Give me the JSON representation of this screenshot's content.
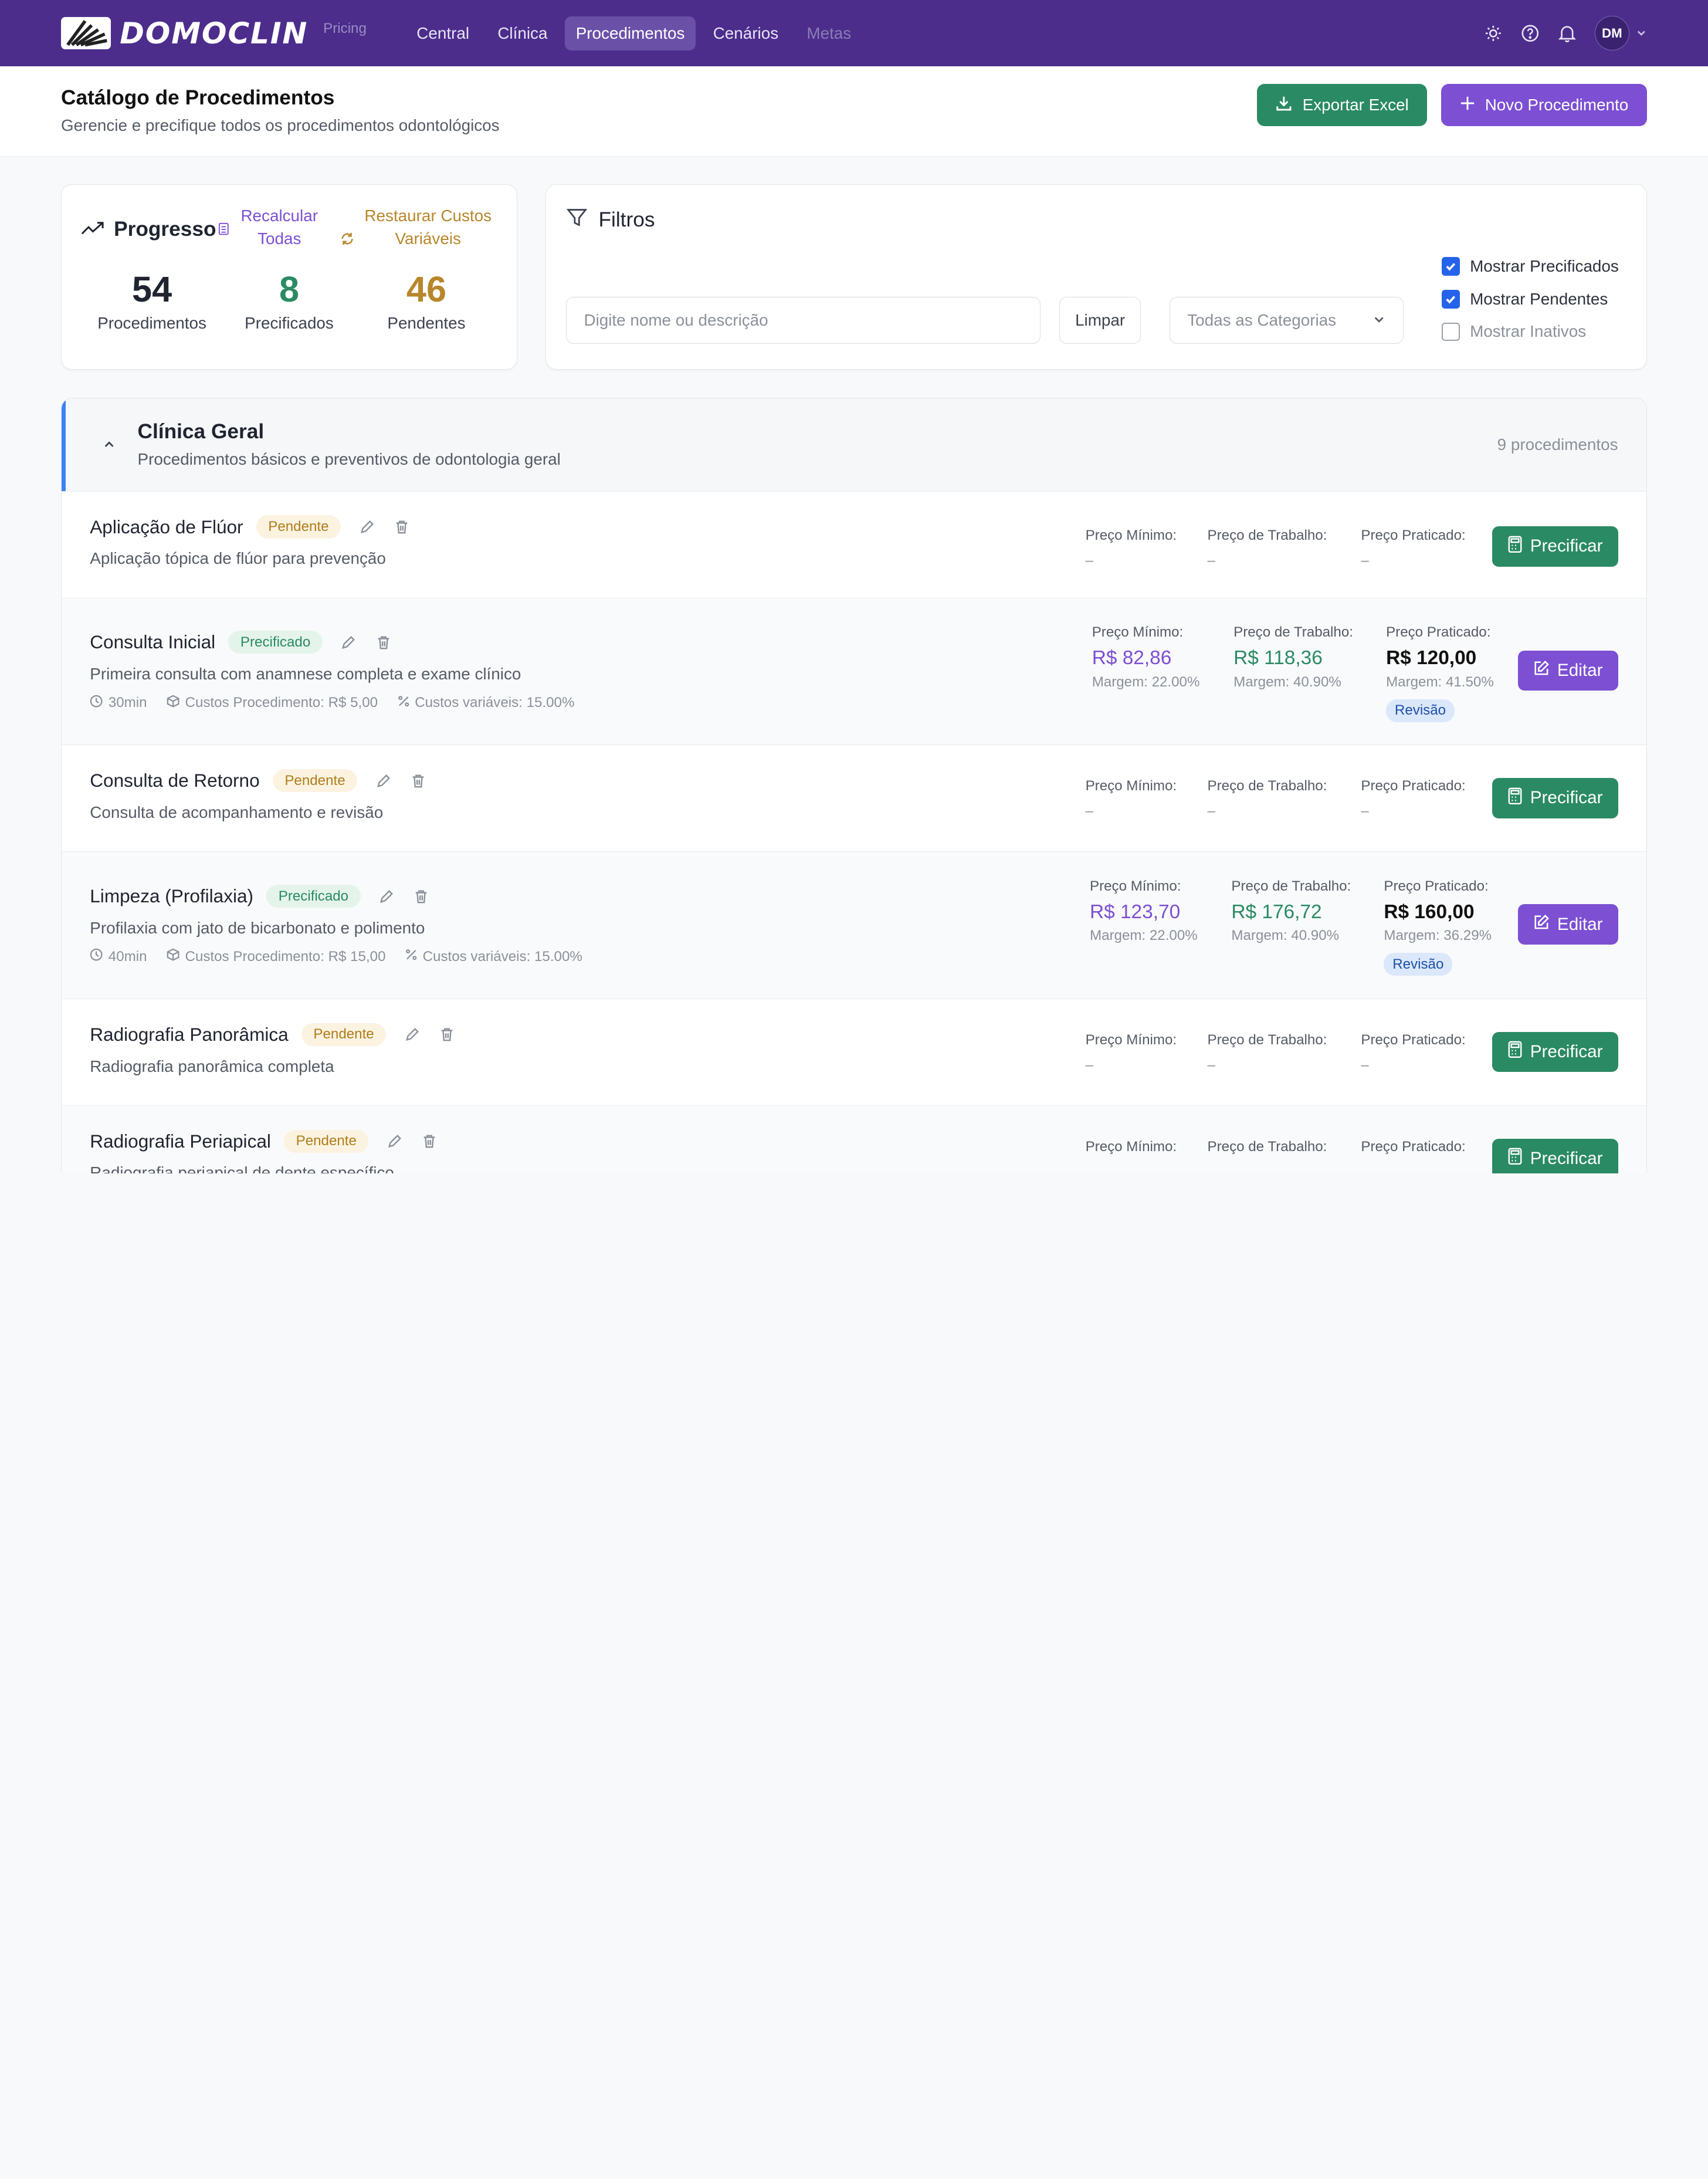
{
  "brand": {
    "name": "DOMOCLIN",
    "sub": "Pricing"
  },
  "nav": [
    {
      "label": "Central",
      "state": "normal"
    },
    {
      "label": "Clínica",
      "state": "normal"
    },
    {
      "label": "Procedimentos",
      "state": "active"
    },
    {
      "label": "Cenários",
      "state": "normal"
    },
    {
      "label": "Metas",
      "state": "disabled"
    }
  ],
  "user": {
    "initials": "DM"
  },
  "page": {
    "title": "Catálogo de Procedimentos",
    "subtitle": "Gerencie e precifique todos os procedimentos odontológicos",
    "export_label": "Exportar Excel",
    "new_label": "Novo Procedimento"
  },
  "progress": {
    "title": "Progresso",
    "recalc_label": "Recalcular Todas",
    "restore_label": "Restaurar Custos Variáveis",
    "stats": [
      {
        "value": "54",
        "label": "Procedimentos",
        "color": "#1f2430"
      },
      {
        "value": "8",
        "label": "Precificados",
        "color": "#2a8a63"
      },
      {
        "value": "46",
        "label": "Pendentes",
        "color": "#b8862b"
      }
    ]
  },
  "filters": {
    "title": "Filtros",
    "search_placeholder": "Digite nome ou descrição",
    "clear_label": "Limpar",
    "category_value": "Todas as Categorias",
    "checks": [
      {
        "label": "Mostrar Precificados",
        "checked": true
      },
      {
        "label": "Mostrar Pendentes",
        "checked": true
      },
      {
        "label": "Mostrar Inativos",
        "checked": false
      }
    ]
  },
  "category": {
    "title": "Clínica Geral",
    "subtitle": "Procedimentos básicos e preventivos de odontologia geral",
    "count": "9 procedimentos"
  },
  "labels": {
    "min": "Preço Mínimo:",
    "work": "Preço de Trabalho:",
    "practiced": "Preço Praticado:",
    "dash": "–",
    "price_btn": "Precificar",
    "edit_btn": "Editar",
    "review": "Revisão"
  },
  "procedures": [
    {
      "name": "Aplicação de Flúor",
      "status": "Pendente",
      "desc": "Aplicação tópica de flúor para prevenção"
    },
    {
      "name": "Consulta Inicial",
      "status": "Precificado",
      "desc": "Primeira consulta com anamnese completa e exame clínico",
      "time": "30min",
      "proc_cost": "Custos Procedimento: R$ 5,00",
      "var_cost": "Custos variáveis: 15.00%",
      "min": "R$ 82,86",
      "min_margin": "Margem: 22.00%",
      "work": "R$ 118,36",
      "work_margin": "Margem: 40.90%",
      "practiced": "R$ 120,00",
      "practiced_margin": "Margem: 41.50%"
    },
    {
      "name": "Consulta de Retorno",
      "status": "Pendente",
      "desc": "Consulta de acompanhamento e revisão"
    },
    {
      "name": "Limpeza (Profilaxia)",
      "status": "Precificado",
      "desc": "Profilaxia com jato de bicarbonato e polimento",
      "time": "40min",
      "proc_cost": "Custos Procedimento: R$ 15,00",
      "var_cost": "Custos variáveis: 15.00%",
      "min": "R$ 123,70",
      "min_margin": "Margem: 22.00%",
      "work": "R$ 176,72",
      "work_margin": "Margem: 40.90%",
      "practiced": "R$ 160,00",
      "practiced_margin": "Margem: 36.29%"
    },
    {
      "name": "Radiografia Panorâmica",
      "status": "Pendente",
      "desc": "Radiografia panorâmica completa"
    },
    {
      "name": "Radiografia Periapical",
      "status": "Pendente",
      "desc": "Radiografia periapical de dente específico"
    }
  ]
}
